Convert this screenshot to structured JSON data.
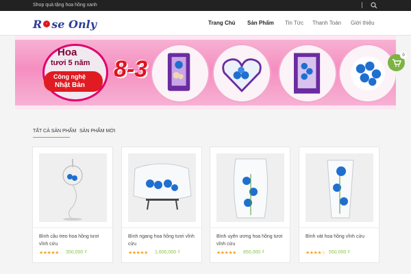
{
  "topbar": {
    "tagline": "Shop quà tặng hoa hồng xanh",
    "separator": "|"
  },
  "logo": {
    "text_left": "R",
    "text_right": "se Only"
  },
  "nav": {
    "items": [
      "Trang Chủ",
      "Sản Phẩm",
      "Tin Tức",
      "Thanh Toán",
      "Giới thiệu"
    ],
    "active": [
      "Trang Chủ",
      "Sản Phẩm"
    ]
  },
  "banner": {
    "headline_1": "Hoa",
    "headline_2": "tươi 5 năm",
    "headline_3": "Công nghệ",
    "headline_4": "Nhật Bản",
    "date": "8-3"
  },
  "cart": {
    "count": "0"
  },
  "tabs": [
    "TẤT CẢ SẢN PHẨM",
    "SẢN PHẨM MỚI"
  ],
  "products": [
    {
      "name": "Bình cầu treo hoa hồng tươi vĩnh cửu",
      "rating": 5,
      "stars": "★★★★★",
      "price": "350,000 ₫"
    },
    {
      "name": "Bình ngang hoa hồng tươi vĩnh cửu",
      "rating": 5,
      "stars": "★★★★★",
      "price": "1,600,000 ₫"
    },
    {
      "name": "Bình uyên ương hoa hồng tươi vĩnh cửu",
      "rating": 5,
      "stars": "★★★★★",
      "price": "850,000 ₫"
    },
    {
      "name": "Bình vát hoa hồng vĩnh cửu",
      "rating": 4,
      "stars": "★★★★☆",
      "price": "550,000 ₫"
    }
  ],
  "colors": {
    "accent": "#7cb342",
    "topbar": "#222222",
    "logo": "#2e3f9a",
    "banner_pink": "#f58ec0",
    "rose_blue": "#1f6fd0"
  },
  "icons": [
    "search-icon",
    "rose-icon",
    "cart-icon"
  ]
}
